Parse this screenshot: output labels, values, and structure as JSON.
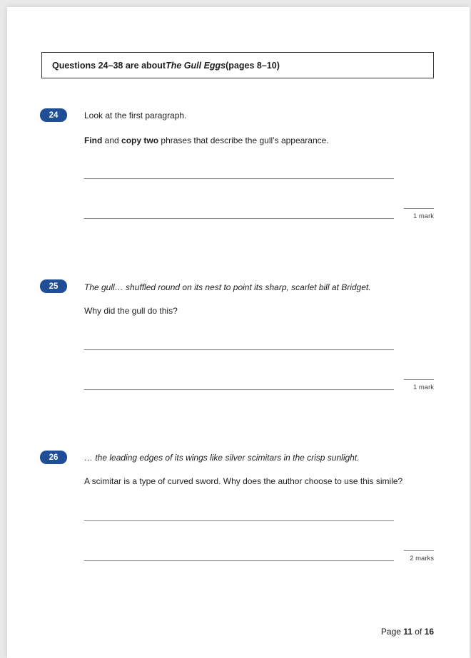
{
  "intro": {
    "prefix": "Questions 24–38 are about ",
    "title": "The Gull Eggs",
    "suffix": " (pages 8–10)"
  },
  "questions": [
    {
      "number": "24",
      "line1": "Look at the first paragraph.",
      "line2_parts": [
        "Find",
        " and ",
        "copy",
        " ",
        "two",
        " phrases that describe the gull’s appearance."
      ],
      "marks": "1 mark"
    },
    {
      "number": "25",
      "quote": "The gull… shuffled round on its nest to point its sharp, scarlet bill at Bridget.",
      "prompt": "Why did the gull do this?",
      "marks": "1 mark"
    },
    {
      "number": "26",
      "quote": "… the leading edges of its wings like silver scimitars in the crisp sunlight.",
      "prompt": "A scimitar is a type of curved sword. Why does the author choose to use this simile?",
      "marks": "2 marks"
    }
  ],
  "footer": {
    "prefix": "Page ",
    "current": "11",
    "middle": " of ",
    "total": "16"
  }
}
